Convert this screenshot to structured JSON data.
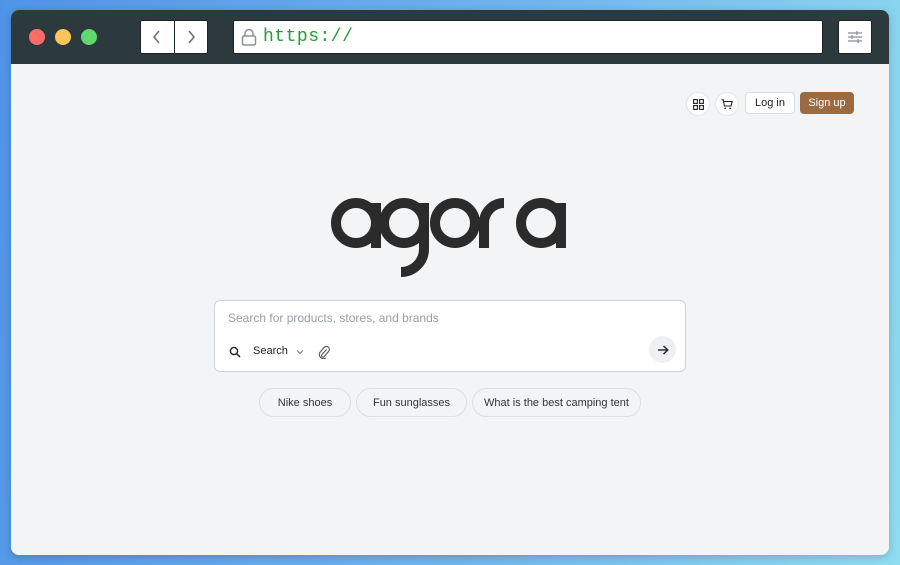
{
  "browser": {
    "url": "https://",
    "icons": {
      "back": "chevron-left-icon",
      "forward": "chevron-right-icon",
      "lock": "lock-icon",
      "settings": "sliders-icon"
    },
    "traffic_light_colors": {
      "close": "#fe6b68",
      "minimize": "#fdc55b",
      "maximize": "#5fd96d"
    }
  },
  "header": {
    "login_label": "Log in",
    "signup_label": "Sign up",
    "icons": {
      "apps": "grid-icon",
      "cart": "cart-icon"
    },
    "signup_color": "#9c6a40"
  },
  "logo": {
    "text": "agora"
  },
  "search": {
    "placeholder": "Search for products, stores, and brands",
    "value": "",
    "mode_label": "Search",
    "icons": {
      "search": "search-icon",
      "mode": "chevron-down-icon",
      "attach": "paperclip-icon",
      "submit": "arrow-right-icon"
    }
  },
  "suggestions": [
    {
      "label": "Nike shoes"
    },
    {
      "label": "Fun sunglasses"
    },
    {
      "label": "What is the best camping tent"
    }
  ]
}
